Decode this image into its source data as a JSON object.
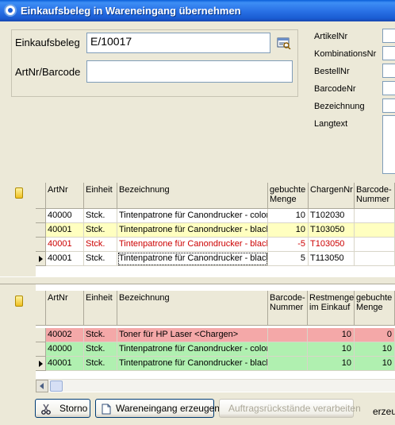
{
  "window": {
    "title": "Einkaufsbeleg in Wareneingang übernehmen"
  },
  "form": {
    "einkaufsbeleg_label": "Einkaufsbeleg",
    "einkaufsbeleg_value": "E/10017",
    "artnr_label": "ArtNr/Barcode",
    "artnr_value": ""
  },
  "details": {
    "artikelnr": "ArtikelNr",
    "kombinationsnr": "KombinationsNr",
    "bestellnr": "BestellNr",
    "barcodenr": "BarcodeNr",
    "bezeichnung": "Bezeichnung",
    "langtext": "Langtext"
  },
  "upper_grid": {
    "headers": {
      "artnr": "ArtNr",
      "einheit": "Einheit",
      "bezeichnung": "Bezeichnung",
      "menge": "gebuchte Menge",
      "chargennr": "ChargenNr",
      "barcode": "Barcode-Nummer"
    },
    "rows": [
      {
        "artnr": "40000",
        "einheit": "Stck.",
        "bezeichnung": "Tintenpatrone für Canondrucker - color",
        "menge": "10",
        "chargennr": "T102030",
        "barcode": "",
        "bg": "#ffffff",
        "fg": "#000000",
        "current": false
      },
      {
        "artnr": "40001",
        "einheit": "Stck.",
        "bezeichnung": "Tintenpatrone für Canondrucker - black",
        "menge": "10",
        "chargennr": "T103050",
        "barcode": "",
        "bg": "#ffffc0",
        "fg": "#000000",
        "current": false
      },
      {
        "artnr": "40001",
        "einheit": "Stck.",
        "bezeichnung": "Tintenpatrone für Canondrucker - black",
        "menge": "-5",
        "chargennr": "T103050",
        "barcode": "",
        "bg": "#ffffff",
        "fg": "#cc0000",
        "current": false
      },
      {
        "artnr": "40001",
        "einheit": "Stck.",
        "bezeichnung": "Tintenpatrone für Canondrucker - black",
        "menge": "5",
        "chargennr": "T113050",
        "barcode": "",
        "bg": "#ffffff",
        "fg": "#000000",
        "current": true
      }
    ]
  },
  "lower_grid": {
    "headers": {
      "artnr": "ArtNr",
      "einheit": "Einheit",
      "bezeichnung": "Bezeichnung",
      "barcode": "Barcode-Nummer",
      "restmenge": "Restmenge im Einkauf",
      "menge": "gebuchte Menge"
    },
    "rows": [
      {
        "artnr": "40002",
        "einheit": "Stck.",
        "bezeichnung": "Toner für HP Laser <Chargen>",
        "barcode": "",
        "restmenge": "10",
        "menge": "0",
        "bg": "#f4a8a8",
        "current": false
      },
      {
        "artnr": "40000",
        "einheit": "Stck.",
        "bezeichnung": "Tintenpatrone für Canondrucker - color",
        "barcode": "",
        "restmenge": "10",
        "menge": "10",
        "bg": "#b0f0b0",
        "current": false
      },
      {
        "artnr": "40001",
        "einheit": "Stck.",
        "bezeichnung": "Tintenpatrone für Canondrucker - black",
        "barcode": "",
        "restmenge": "10",
        "menge": "10",
        "bg": "#b0f0b0",
        "current": true
      }
    ]
  },
  "buttons": {
    "storno": "Storno",
    "wareneingang": "Wareneingang erzeugen",
    "auftragsrueckstaende": "Auftragsrückstände verarbeiten"
  },
  "footer": {
    "cut_text": "erzeug"
  }
}
